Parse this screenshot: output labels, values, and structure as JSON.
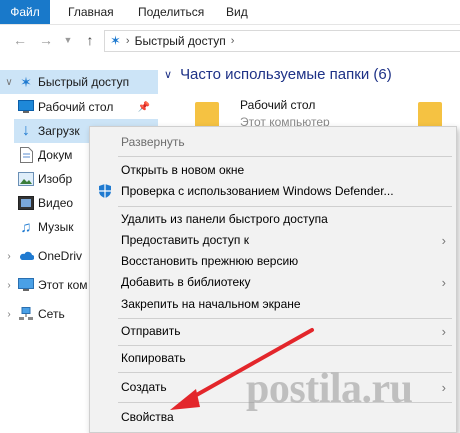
{
  "ribbon": {
    "tabs": [
      "Файл",
      "Главная",
      "Поделиться",
      "Вид"
    ]
  },
  "address": {
    "path": [
      "Быстрый доступ"
    ]
  },
  "nav": {
    "quick_access": "Быстрый доступ",
    "items": [
      {
        "label": "Рабочий стол",
        "icon": "desktop-icon"
      },
      {
        "label": "Загрузк",
        "icon": "download-icon"
      },
      {
        "label": "Докум",
        "icon": "document-icon"
      },
      {
        "label": "Изобр",
        "icon": "pictures-icon"
      },
      {
        "label": "Видео",
        "icon": "video-icon"
      },
      {
        "label": "Музык",
        "icon": "music-icon"
      }
    ],
    "onedrive": "OneDriv",
    "this_pc": "Этот ком",
    "network": "Сеть"
  },
  "main": {
    "section_title": "Часто используемые папки (6)",
    "cards": [
      {
        "title": "Рабочий стол",
        "sub": "Этот компьютер"
      }
    ]
  },
  "context_menu": {
    "items": [
      {
        "label": "Развернуть",
        "disabled": true
      },
      {
        "label": "Открыть в новом окне"
      },
      {
        "label": "Проверка с использованием Windows Defender...",
        "icon": "defender-shield-icon"
      },
      {
        "label": "Удалить из панели быстрого доступа"
      },
      {
        "label": "Предоставить доступ к",
        "submenu": true
      },
      {
        "label": "Восстановить прежнюю версию"
      },
      {
        "label": "Добавить в библиотеку",
        "submenu": true
      },
      {
        "label": "Закрепить на начальном экране"
      },
      {
        "label": "Отправить",
        "submenu": true
      },
      {
        "label": "Копировать"
      },
      {
        "label": "Создать",
        "submenu": true
      },
      {
        "label": "Свойства"
      }
    ]
  },
  "watermark": "postila.ru",
  "colors": {
    "file_tab": "#1979ca",
    "selection": "#cce4f7",
    "section_title": "#1e3287",
    "arrow": "#e3262b"
  }
}
